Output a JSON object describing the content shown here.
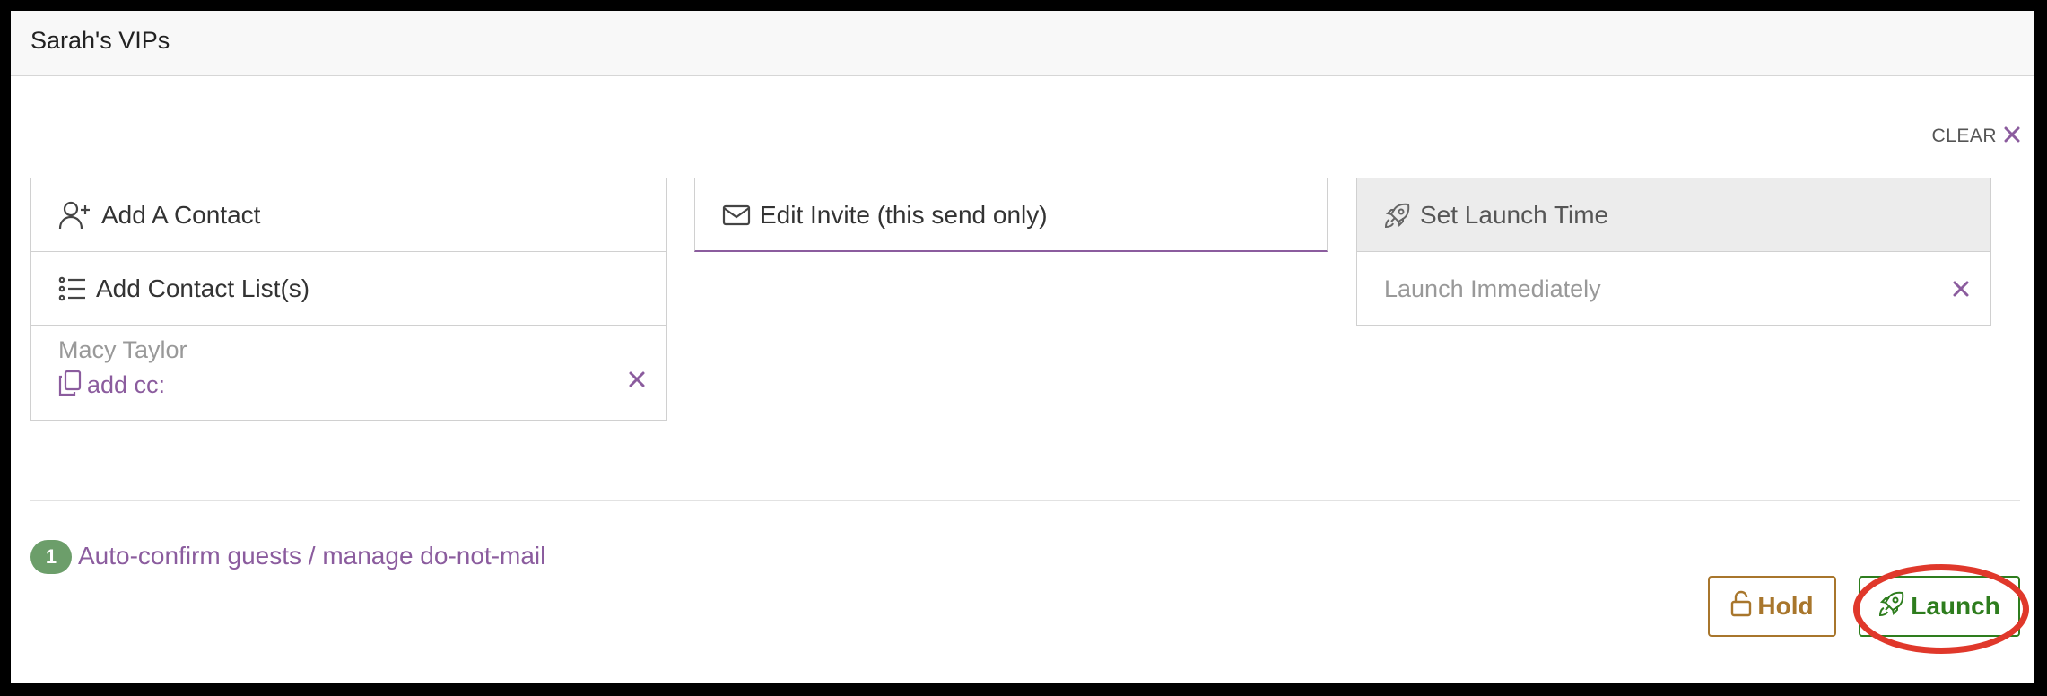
{
  "header": {
    "title": "Sarah's VIPs"
  },
  "clear": {
    "label": "CLEAR"
  },
  "contacts_panel": {
    "add_contact_label": "Add A Contact",
    "add_list_label": "Add Contact List(s)",
    "selected_contact": {
      "name": "Macy Taylor",
      "cc_label": "add cc:"
    }
  },
  "invite_panel": {
    "edit_label": "Edit Invite (this send only)"
  },
  "launch_panel": {
    "set_time_label": "Set Launch Time",
    "time_value": "Launch Immediately"
  },
  "footer": {
    "badge_count": "1",
    "auto_confirm_label": "Auto-confirm guests / manage do-not-mail",
    "hold_label": "Hold",
    "launch_label": "Launch"
  },
  "colors": {
    "accent_purple": "#8b5c9e",
    "hold_gold": "#a8762c",
    "launch_green": "#2e7d1e",
    "badge_green": "#6c9e6a",
    "highlight_red": "#e0382b"
  }
}
